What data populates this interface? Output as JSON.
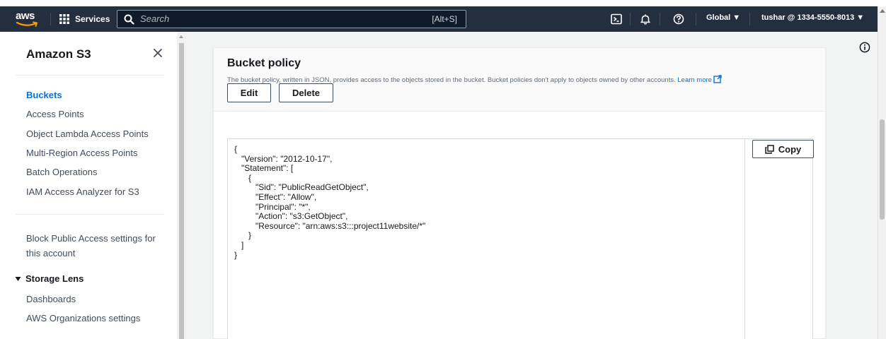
{
  "topnav": {
    "logo_text": "aws",
    "services_label": "Services",
    "search_placeholder": "Search",
    "search_shortcut": "[Alt+S]",
    "region_label": "Global ▼",
    "account_label": "tushar @ 1334-5550-8013 ▼"
  },
  "sidebar": {
    "title": "Amazon S3",
    "items": [
      {
        "label": "Buckets",
        "active": true
      },
      {
        "label": "Access Points"
      },
      {
        "label": "Object Lambda Access Points"
      },
      {
        "label": "Multi-Region Access Points"
      },
      {
        "label": "Batch Operations"
      },
      {
        "label": "IAM Access Analyzer for S3"
      }
    ],
    "block_public_access": "Block Public Access settings for this account",
    "storage_lens": {
      "label": "Storage Lens",
      "items": [
        {
          "label": "Dashboards"
        },
        {
          "label": "AWS Organizations settings"
        }
      ]
    }
  },
  "bucket_policy": {
    "title": "Bucket policy",
    "description": "The bucket policy, written in JSON, provides access to the objects stored in the bucket. Bucket policies don't apply to objects owned by other accounts.",
    "learn_more": "Learn more",
    "edit_label": "Edit",
    "delete_label": "Delete",
    "copy_label": "Copy",
    "code_lines": [
      "{",
      "   \"Version\": \"2012-10-17\",",
      "   \"Statement\": [",
      "      {",
      "         \"Sid\": \"PublicReadGetObject\",",
      "         \"Effect\": \"Allow\",",
      "         \"Principal\": \"*\",",
      "         \"Action\": \"s3:GetObject\",",
      "         \"Resource\": \"arn:aws:s3:::project11website/*\"",
      "      }",
      "   ]",
      "}"
    ]
  }
}
